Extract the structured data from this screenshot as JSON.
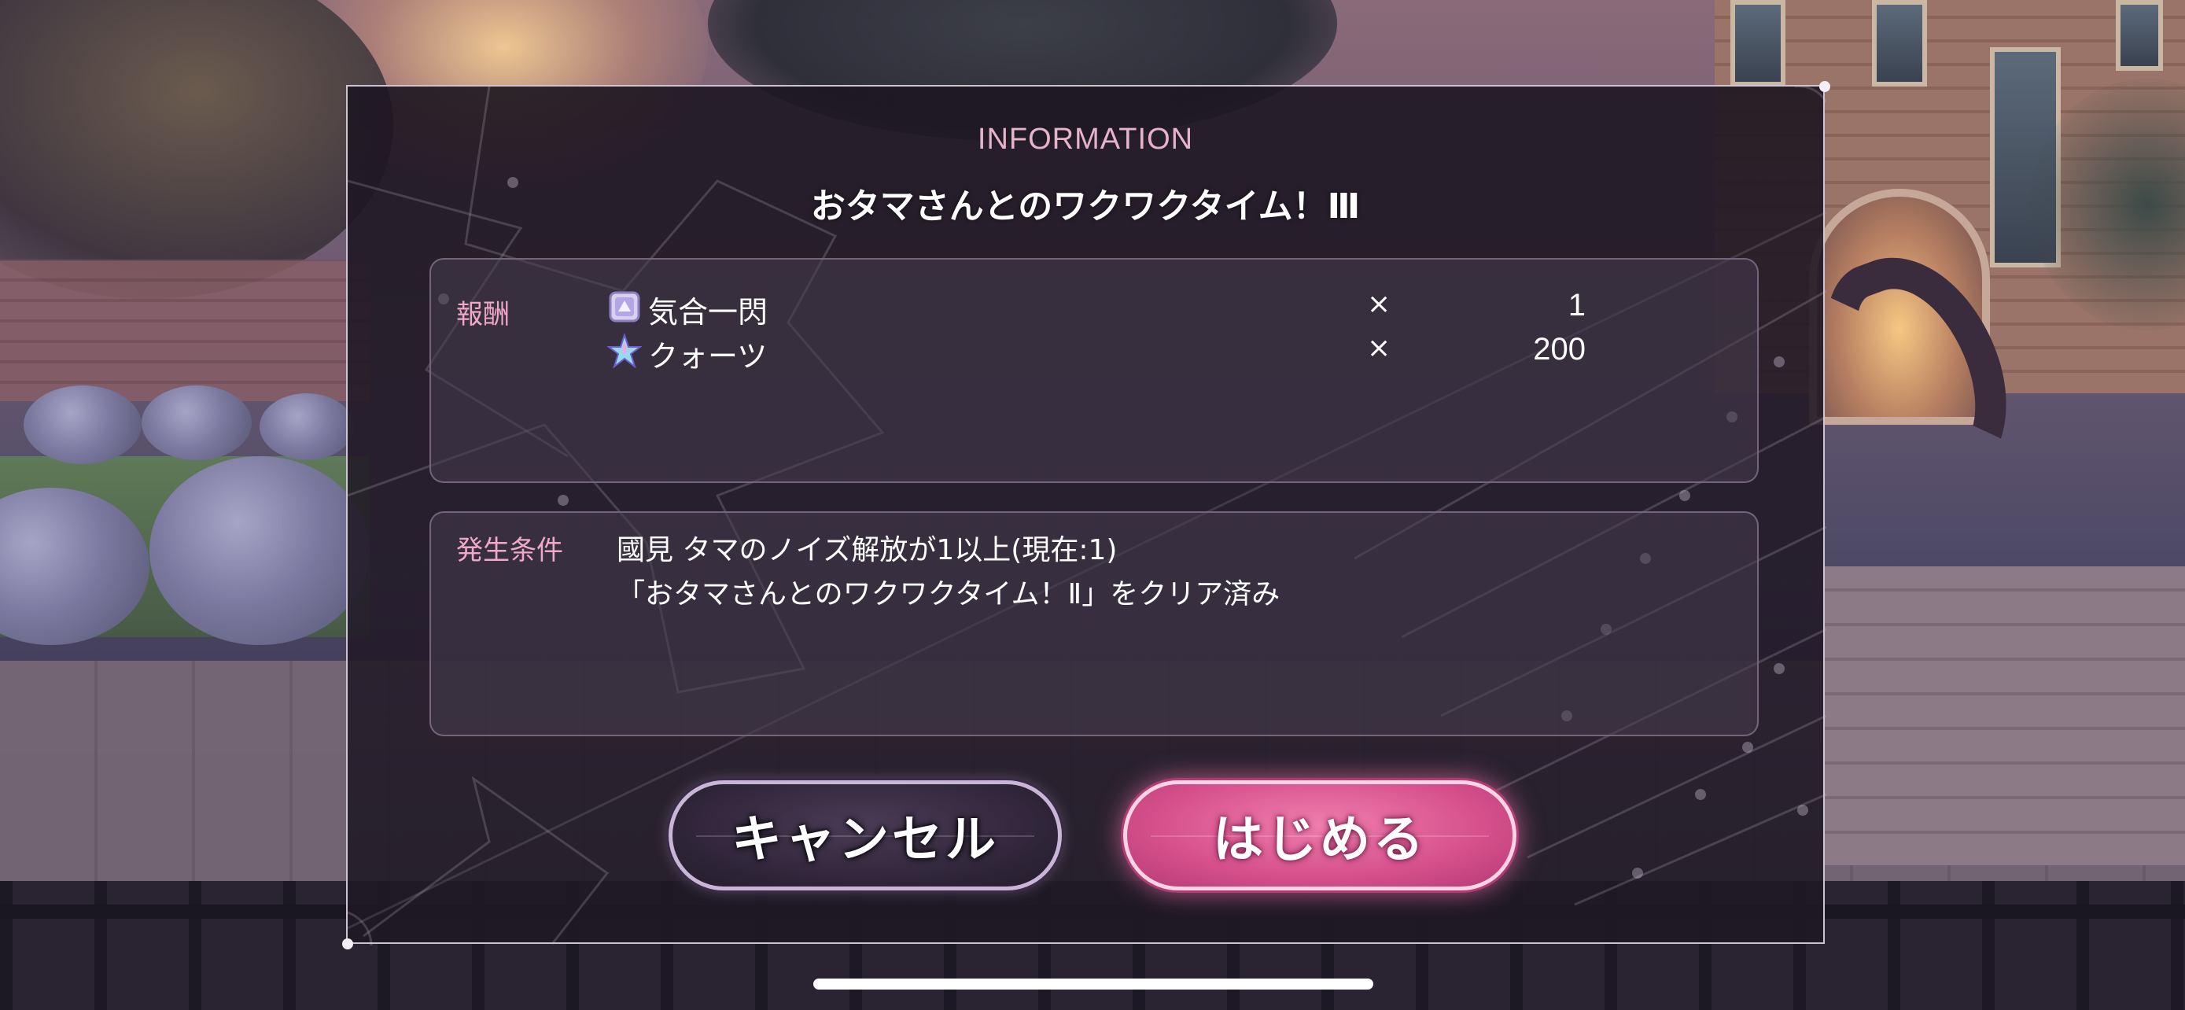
{
  "dialog": {
    "category": "INFORMATION",
    "title": "おタマさんとのワクワクタイム！Ⅲ"
  },
  "reward": {
    "label": "報酬",
    "items": [
      {
        "icon": "skill-card-icon",
        "name": "気合一閃",
        "multiplier": "×",
        "quantity": "1"
      },
      {
        "icon": "quartz-star-icon",
        "name": "クォーツ",
        "multiplier": "×",
        "quantity": "200"
      }
    ]
  },
  "condition": {
    "label": "発生条件",
    "lines": [
      "國見 タマのノイズ解放が1以上(現在:1)",
      "「おタマさんとのワクワクタイム！Ⅱ」をクリア済み"
    ]
  },
  "buttons": {
    "cancel_label": "キャンセル",
    "start_label": "はじめる"
  },
  "colors": {
    "accent_pink": "#e0609a",
    "label_pink": "#f0a8c8",
    "category_pink": "#e6b3c8"
  }
}
